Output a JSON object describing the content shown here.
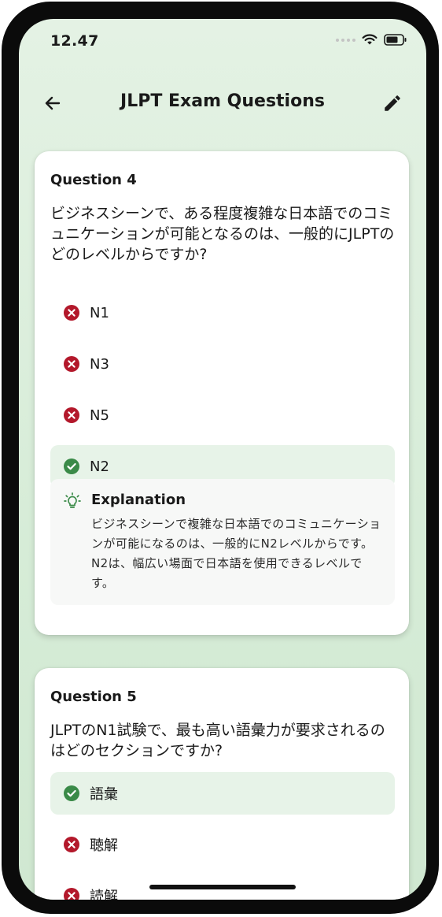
{
  "status_bar": {
    "time": "12.47"
  },
  "header": {
    "title": "JLPT Exam Questions"
  },
  "questions": [
    {
      "label": "Question 4",
      "text": "ビジネスシーンで、ある程度複雑な日本語でのコミュニケーションが可能となるのは、一般的にJLPTのどのレベルからですか?",
      "options": [
        {
          "label": "N1",
          "state": "wrong"
        },
        {
          "label": "N3",
          "state": "wrong"
        },
        {
          "label": "N5",
          "state": "wrong"
        },
        {
          "label": "N2",
          "state": "correct"
        }
      ],
      "explanation": {
        "title": "Explanation",
        "text": "ビジネスシーンで複雑な日本語でのコミュニケーションが可能になるのは、一般的にN2レベルからです。N2は、幅広い場面で日本語を使用できるレベルです。"
      }
    },
    {
      "label": "Question 5",
      "text": "JLPTのN1試験で、最も高い語彙力が要求されるのはどのセクションですか?",
      "options": [
        {
          "label": "語彙",
          "state": "correct"
        },
        {
          "label": "聴解",
          "state": "wrong"
        },
        {
          "label": "読解",
          "state": "wrong"
        }
      ]
    }
  ],
  "colors": {
    "correct": "#3a8a48",
    "wrong": "#b3182b",
    "correct_bg": "#e7f3e8",
    "screen_bg": "#dcefdc"
  },
  "icons": {
    "back": "arrow-left-icon",
    "edit": "pencil-icon",
    "wrong": "x-circle-icon",
    "correct": "check-circle-icon",
    "explanation": "lightbulb-icon"
  }
}
